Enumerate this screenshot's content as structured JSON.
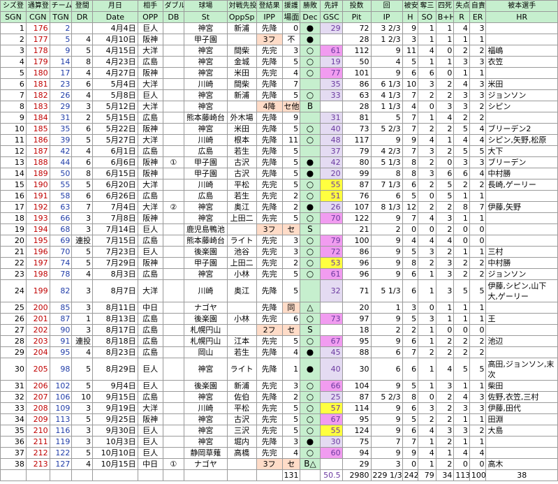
{
  "headers_jp": [
    "シズ登",
    "通算登",
    "チーム試",
    "登間",
    "月日",
    "相手",
    "ダブル",
    "球場",
    "対戦先投",
    "登結果",
    "援護",
    "勝敗",
    "先評",
    "投数",
    "回",
    "被安",
    "奪三",
    "四死",
    "失点",
    "自責",
    "被本選手"
  ],
  "headers_en": [
    "SGN",
    "CGN",
    "TGN",
    "DR",
    "Date",
    "OPP",
    "DB",
    "St",
    "OppSp",
    "IPP",
    "場面",
    "Dec",
    "GSC",
    "Pit",
    "IP",
    "H",
    "SO",
    "B+H",
    "R",
    "ER",
    "HR"
  ],
  "rows": [
    [
      "1",
      "176",
      "2",
      "",
      "4月4日",
      "巨人",
      "",
      "神宮",
      "新浦",
      "先降",
      "0",
      "●",
      "29",
      "72",
      "3 2/3",
      "9",
      "1",
      "1",
      "4",
      "3",
      ""
    ],
    [
      "2",
      "177",
      "5",
      "4",
      "4月10日",
      "阪神",
      "",
      "甲子園",
      "",
      "3フ",
      "不",
      "●",
      "",
      "28",
      "1 2/3",
      "3",
      "1",
      "1",
      "1",
      "1",
      ""
    ],
    [
      "3",
      "178",
      "9",
      "5",
      "4月15日",
      "大洋",
      "",
      "神宮",
      "間柴",
      "先完",
      "3",
      "○",
      "61",
      "112",
      "9",
      "11",
      "4",
      "0",
      "2",
      "2",
      "福嶋"
    ],
    [
      "4",
      "179",
      "14",
      "8",
      "4月23日",
      "広島",
      "",
      "神宮",
      "金城",
      "先降",
      "5",
      "○",
      "19",
      "50",
      "4",
      "5",
      "1",
      "1",
      "3",
      "3",
      "衣笠"
    ],
    [
      "5",
      "180",
      "17",
      "4",
      "4月27日",
      "阪神",
      "",
      "神宮",
      "米田",
      "先完",
      "4",
      "○",
      "77",
      "101",
      "9",
      "6",
      "6",
      "0",
      "1",
      "1",
      ""
    ],
    [
      "6",
      "181",
      "23",
      "6",
      "5月4日",
      "大洋",
      "",
      "川崎",
      "間柴",
      "先降",
      "7",
      "",
      "35",
      "86",
      "6 1/3",
      "10",
      "3",
      "2",
      "4",
      "3",
      "米田"
    ],
    [
      "7",
      "182",
      "26",
      "4",
      "5月8日",
      "巨人",
      "",
      "神宮",
      "新浦",
      "先降",
      "5",
      "○",
      "33",
      "63",
      "4 1/3",
      "7",
      "2",
      "2",
      "3",
      "3",
      "ジョンソン"
    ],
    [
      "8",
      "183",
      "29",
      "3",
      "5月12日",
      "大洋",
      "",
      "神宮",
      "",
      "4降",
      "セ他",
      "B",
      "",
      "28",
      "1 1/3",
      "4",
      "0",
      "3",
      "3",
      "2",
      "シピン"
    ],
    [
      "9",
      "184",
      "31",
      "2",
      "5月15日",
      "広島",
      "",
      "熊本藤崎台",
      "外木場",
      "先降",
      "9",
      "",
      "31",
      "81",
      "5",
      "7",
      "1",
      "4",
      "2",
      "2",
      ""
    ],
    [
      "10",
      "185",
      "35",
      "6",
      "5月22日",
      "阪神",
      "",
      "神宮",
      "米田",
      "先降",
      "5",
      "○",
      "40",
      "73",
      "5 2/3",
      "7",
      "2",
      "2",
      "5",
      "4",
      "ブリーデン2"
    ],
    [
      "11",
      "186",
      "39",
      "5",
      "5月27日",
      "大洋",
      "",
      "川崎",
      "根本",
      "先降",
      "11",
      "○",
      "48",
      "117",
      "9",
      "9",
      "4",
      "1",
      "4",
      "4",
      "シピン,矢野,松原"
    ],
    [
      "12",
      "187",
      "42",
      "4",
      "6月1日",
      "広島",
      "",
      "広島",
      "若生",
      "先降",
      "5",
      "",
      "37",
      "79",
      "4 2/3",
      "7",
      "3",
      "2",
      "5",
      "5",
      "大下"
    ],
    [
      "13",
      "188",
      "44",
      "6",
      "6月6日",
      "阪神",
      "①",
      "甲子園",
      "古沢",
      "先降",
      "5",
      "●",
      "42",
      "80",
      "5 1/3",
      "8",
      "2",
      "0",
      "3",
      "3",
      "ブリーデン"
    ],
    [
      "14",
      "189",
      "50",
      "8",
      "6月15日",
      "阪神",
      "",
      "甲子園",
      "古沢",
      "先降",
      "5",
      "●",
      "20",
      "99",
      "8",
      "8",
      "3",
      "6",
      "6",
      "4",
      "中村勝"
    ],
    [
      "15",
      "190",
      "55",
      "5",
      "6月20日",
      "大洋",
      "",
      "川崎",
      "平松",
      "先完",
      "5",
      "○",
      "55",
      "87",
      "7 1/3",
      "6",
      "2",
      "5",
      "2",
      "2",
      "長崎,ゲーリー"
    ],
    [
      "16",
      "191",
      "58",
      "6",
      "6月26日",
      "広島",
      "",
      "広島",
      "若生",
      "先完",
      "2",
      "○",
      "51",
      "76",
      "6",
      "5",
      "0",
      "5",
      "1",
      "1",
      ""
    ],
    [
      "17",
      "192",
      "63",
      "7",
      "7月4日",
      "大洋",
      "②",
      "神宮",
      "奥江",
      "先降",
      "2",
      "●",
      "26",
      "107",
      "8 1/3",
      "12",
      "2",
      "2",
      "8",
      "7",
      "伊藤,矢野"
    ],
    [
      "18",
      "193",
      "66",
      "3",
      "7月8日",
      "阪神",
      "",
      "神宮",
      "上田二",
      "先完",
      "5",
      "○",
      "70",
      "122",
      "9",
      "7",
      "4",
      "3",
      "1",
      "1",
      ""
    ],
    [
      "19",
      "194",
      "68",
      "3",
      "7月14日",
      "巨人",
      "",
      "鹿児島鴨池",
      "",
      "3フ",
      "セ",
      "S",
      "",
      "21",
      "2",
      "0",
      "0",
      "2",
      "0",
      "0",
      ""
    ],
    [
      "20",
      "195",
      "69",
      "連投",
      "7月15日",
      "広島",
      "",
      "熊本藤崎台",
      "ライト",
      "先完",
      "3",
      "○",
      "79",
      "100",
      "9",
      "4",
      "4",
      "4",
      "0",
      "0",
      ""
    ],
    [
      "21",
      "196",
      "70",
      "5",
      "7月23日",
      "巨人",
      "",
      "後楽園",
      "池谷",
      "先完",
      "3",
      "○",
      "72",
      "86",
      "9",
      "5",
      "3",
      "2",
      "1",
      "1",
      "三村"
    ],
    [
      "22",
      "197",
      "74",
      "5",
      "7月29日",
      "阪神",
      "",
      "甲子園",
      "上田二",
      "先完",
      "2",
      "○",
      "53",
      "96",
      "9",
      "8",
      "2",
      "3",
      "2",
      "2",
      "中村勝"
    ],
    [
      "23",
      "198",
      "78",
      "4",
      "8月3日",
      "広島",
      "",
      "神宮",
      "小林",
      "先完",
      "5",
      "○",
      "61",
      "96",
      "9",
      "6",
      "1",
      "3",
      "2",
      "2",
      "ジョンソン"
    ],
    [
      "24",
      "199",
      "82",
      "3",
      "8月7日",
      "大洋",
      "",
      "川崎",
      "奥江",
      "先降",
      "5",
      "",
      "32",
      "71",
      "5 1/3",
      "6",
      "1",
      "3",
      "5",
      "5",
      "伊藤,シピン,山下大,ゲーリー"
    ],
    [
      "25",
      "200",
      "85",
      "3",
      "8月11日",
      "中日",
      "",
      "ナゴヤ",
      "",
      "先降",
      "同",
      "△",
      "",
      "20",
      "1",
      "3",
      "0",
      "1",
      "1",
      "1",
      ""
    ],
    [
      "26",
      "201",
      "87",
      "1",
      "8月13日",
      "広島",
      "",
      "後楽園",
      "小林",
      "先完",
      "6",
      "○",
      "73",
      "97",
      "9",
      "5",
      "3",
      "1",
      "1",
      "1",
      "王"
    ],
    [
      "27",
      "202",
      "90",
      "3",
      "8月17日",
      "広島",
      "",
      "札幌円山",
      "",
      "2フ",
      "セ",
      "S",
      "",
      "18",
      "2",
      "2",
      "1",
      "0",
      "0",
      "0",
      ""
    ],
    [
      "28",
      "203",
      "91",
      "連投",
      "8月18日",
      "広島",
      "",
      "札幌円山",
      "江本",
      "先完",
      "5",
      "○",
      "67",
      "95",
      "9",
      "6",
      "1",
      "2",
      "2",
      "2",
      "池辺"
    ],
    [
      "29",
      "204",
      "95",
      "4",
      "8月23日",
      "広島",
      "",
      "岡山",
      "若生",
      "先降",
      "4",
      "●",
      "45",
      "88",
      "6",
      "7",
      "2",
      "2",
      "2",
      "2",
      ""
    ],
    [
      "30",
      "205",
      "98",
      "5",
      "8月29日",
      "巨人",
      "",
      "神宮",
      "ライト",
      "先降",
      "1",
      "●",
      "40",
      "30",
      "6",
      "6",
      "1",
      "4",
      "5",
      "5",
      "高田,ジョンソン,末次"
    ],
    [
      "31",
      "206",
      "102",
      "5",
      "9月4日",
      "巨人",
      "",
      "後楽園",
      "新浦",
      "先完",
      "3",
      "○",
      "66",
      "104",
      "9",
      "5",
      "1",
      "3",
      "1",
      "1",
      "柴田"
    ],
    [
      "32",
      "207",
      "106",
      "10",
      "9月15日",
      "広島",
      "",
      "神宮",
      "佐伯",
      "先降",
      "2",
      "○",
      "25",
      "87",
      "5 2/3",
      "8",
      "0",
      "2",
      "4",
      "3",
      "佐野,衣笠,三村"
    ],
    [
      "33",
      "208",
      "109",
      "3",
      "9月19日",
      "大洋",
      "",
      "川崎",
      "平松",
      "先完",
      "5",
      "○",
      "57",
      "114",
      "9",
      "6",
      "3",
      "2",
      "3",
      "3",
      "伊藤,田代"
    ],
    [
      "34",
      "209",
      "113",
      "5",
      "9月25日",
      "阪神",
      "",
      "神宮",
      "古沢",
      "先完",
      "5",
      "○",
      "67",
      "95",
      "9",
      "5",
      "2",
      "2",
      "1",
      "1",
      "田淵"
    ],
    [
      "35",
      "210",
      "116",
      "3",
      "9月30日",
      "巨人",
      "",
      "神宮",
      "三沢",
      "先完",
      "5",
      "○",
      "55",
      "124",
      "9",
      "6",
      "4",
      "3",
      "3",
      "2",
      "大島"
    ],
    [
      "36",
      "211",
      "119",
      "3",
      "10月3日",
      "巨人",
      "",
      "神宮",
      "堀内",
      "先降",
      "3",
      "●",
      "30",
      "75",
      "7",
      "7",
      "1",
      "2",
      "1",
      "1",
      ""
    ],
    [
      "37",
      "212",
      "122",
      "5",
      "10月10日",
      "巨人",
      "",
      "静岡草薙",
      "高橋",
      "先完",
      "4",
      "○",
      "60",
      "94",
      "9",
      "9",
      "4",
      "1",
      "4",
      "4",
      ""
    ],
    [
      "38",
      "213",
      "127",
      "4",
      "10月15日",
      "中日",
      "①",
      "ナゴヤ",
      "",
      "3フ",
      "セ",
      "B△",
      "",
      "29",
      "3",
      "0",
      "1",
      "2",
      "0",
      "0",
      "高木"
    ]
  ],
  "totals": [
    "131",
    "50.5",
    "2980",
    "229 1/3",
    "242",
    "79",
    "34",
    "113",
    "100",
    "38"
  ]
}
